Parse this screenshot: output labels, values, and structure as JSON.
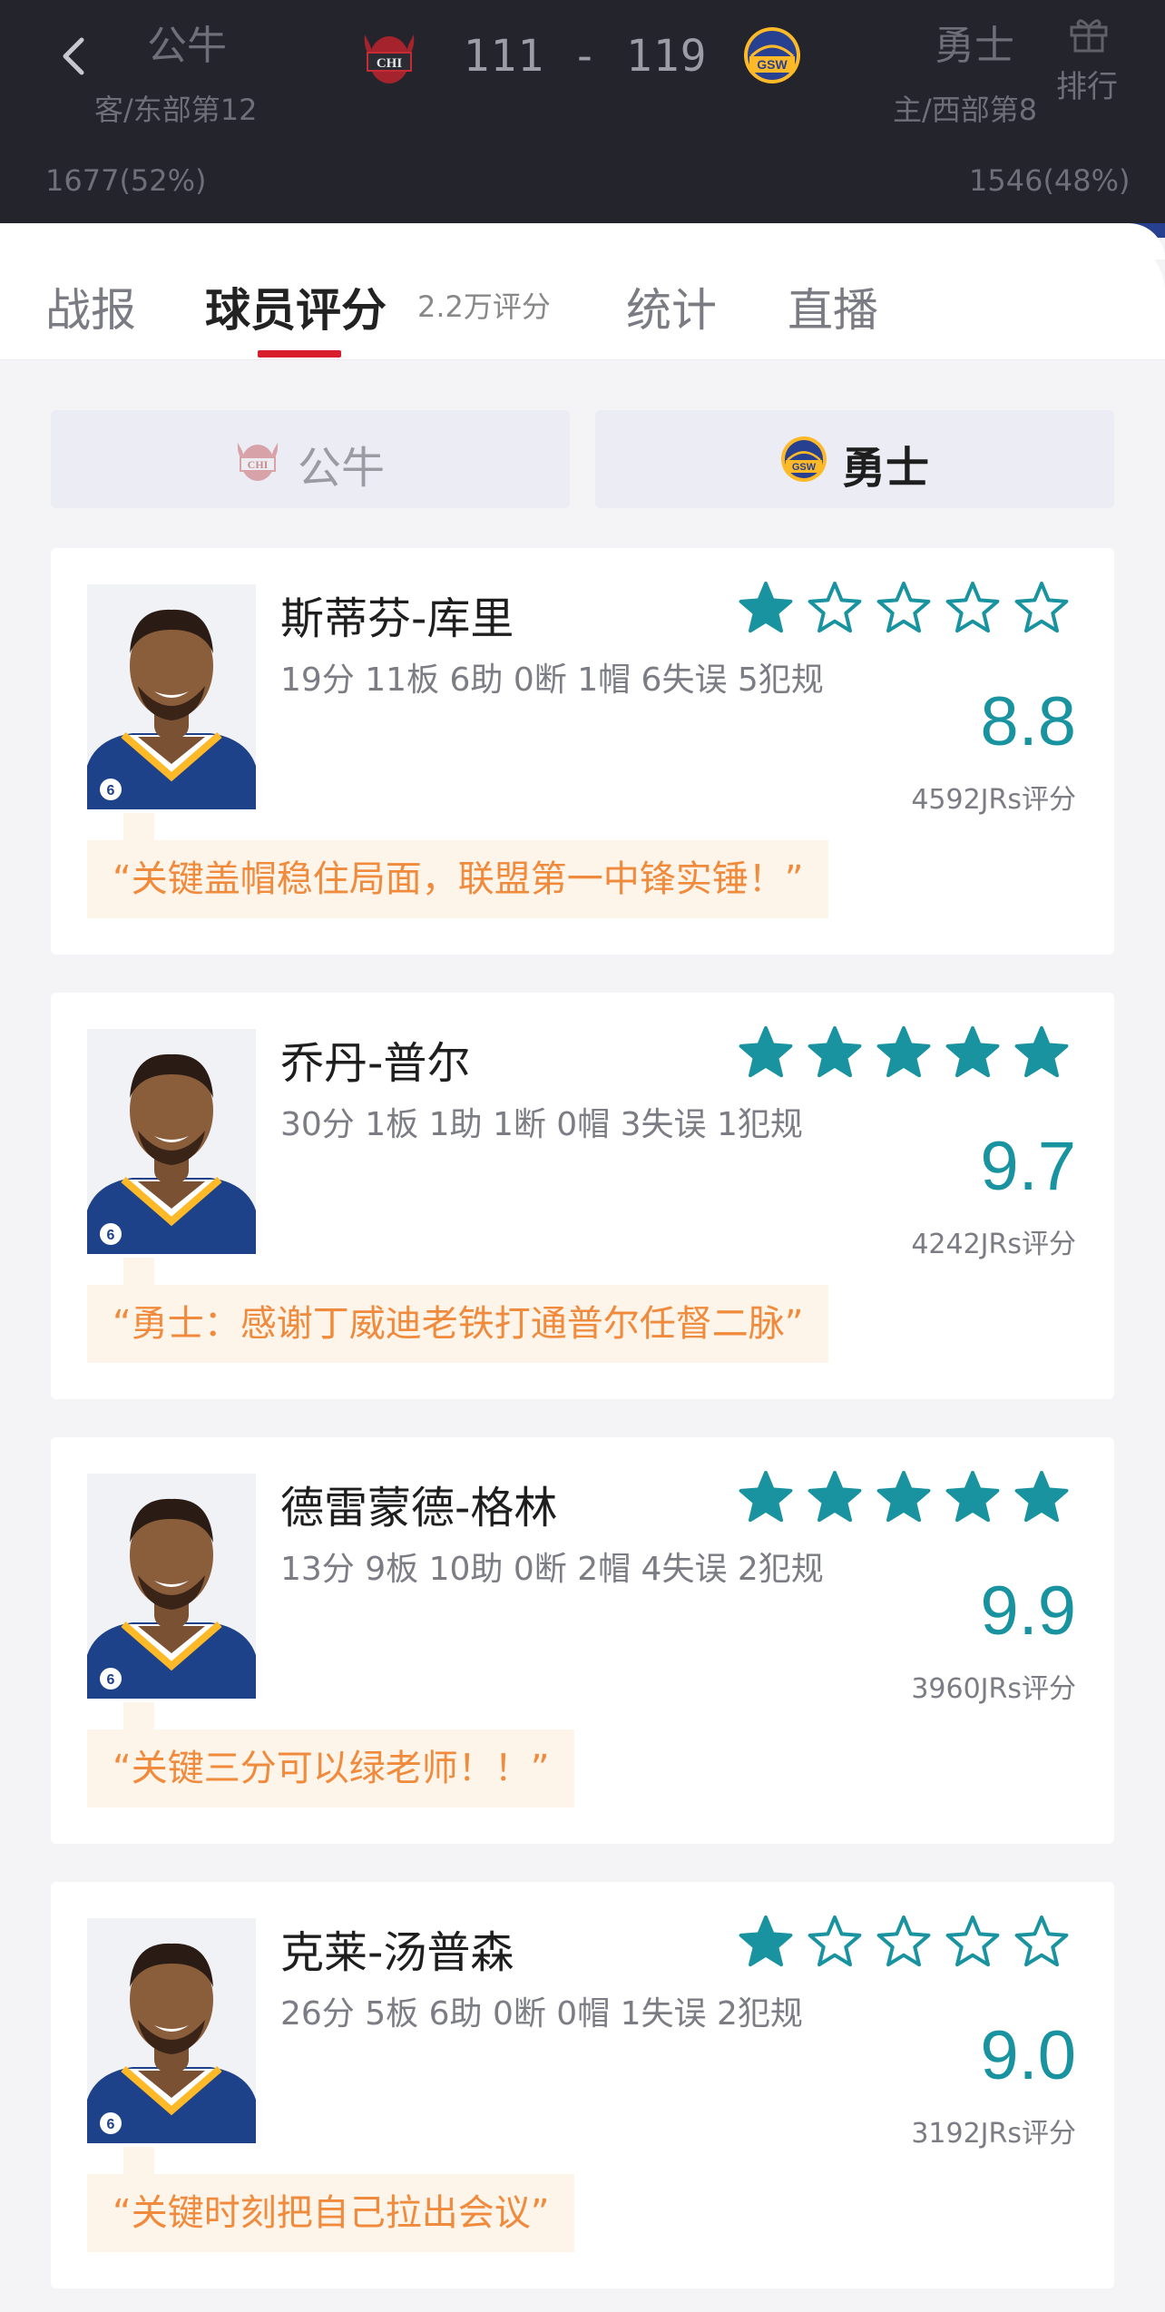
{
  "header": {
    "away_team": "公牛",
    "away_rank": "客/东部第12",
    "away_votes": "1677(52%)",
    "away_abbr": "CHI",
    "away_color": "#a5232d",
    "score": "111 - 119",
    "home_team": "勇士",
    "home_rank": "主/西部第8",
    "home_votes": "1546(48%)",
    "home_abbr": "GSW",
    "home_color": "#27408f",
    "rank_label": "排行",
    "icons": [
      "back-icon",
      "gift-icon"
    ]
  },
  "tabs": {
    "items": [
      "战报",
      "球员评分",
      "统计",
      "直播"
    ],
    "active": "球员评分",
    "rating_count": "2.2万评分",
    "underline_color": "#d81e2c"
  },
  "team_toggle": {
    "left": "公牛",
    "right": "勇士",
    "selected": "勇士"
  },
  "players": [
    {
      "name": "斯蒂芬-库里",
      "stats": "19分 11板 6助 0断 1帽 6失误 5犯规",
      "stars_filled": 1,
      "rating": "8.8",
      "jrs_count": "4592JRs评分",
      "quote": "“关键盖帽稳住局面，联盟第一中锋实锤！”",
      "jersey": "6"
    },
    {
      "name": "乔丹-普尔",
      "stats": "30分 1板 1助 1断 0帽 3失误 1犯规",
      "stars_filled": 5,
      "rating": "9.7",
      "jrs_count": "4242JRs评分",
      "quote": "“勇士：感谢丁威迪老铁打通普尔任督二脉”",
      "jersey": "6"
    },
    {
      "name": "德雷蒙德-格林",
      "stats": "13分 9板 10助 0断 2帽 4失误 2犯规",
      "stars_filled": 5,
      "rating": "9.9",
      "jrs_count": "3960JRs评分",
      "quote": "“关键三分可以绿老师！！”",
      "jersey": "6"
    },
    {
      "name": "克莱-汤普森",
      "stats": "26分 5板 6助 0断 0帽 1失误 2犯规",
      "stars_filled": 1,
      "rating": "9.0",
      "jrs_count": "3192JRs评分",
      "quote": "“关键时刻把自己拉出会议”",
      "jersey": "6"
    }
  ],
  "colors": {
    "accent_teal": "#19939f",
    "quote_orange": "#f08a3c",
    "quote_bg": "#fdf5ea",
    "jersey_blue": "#1d428a",
    "jersey_gold": "#fdb927"
  }
}
